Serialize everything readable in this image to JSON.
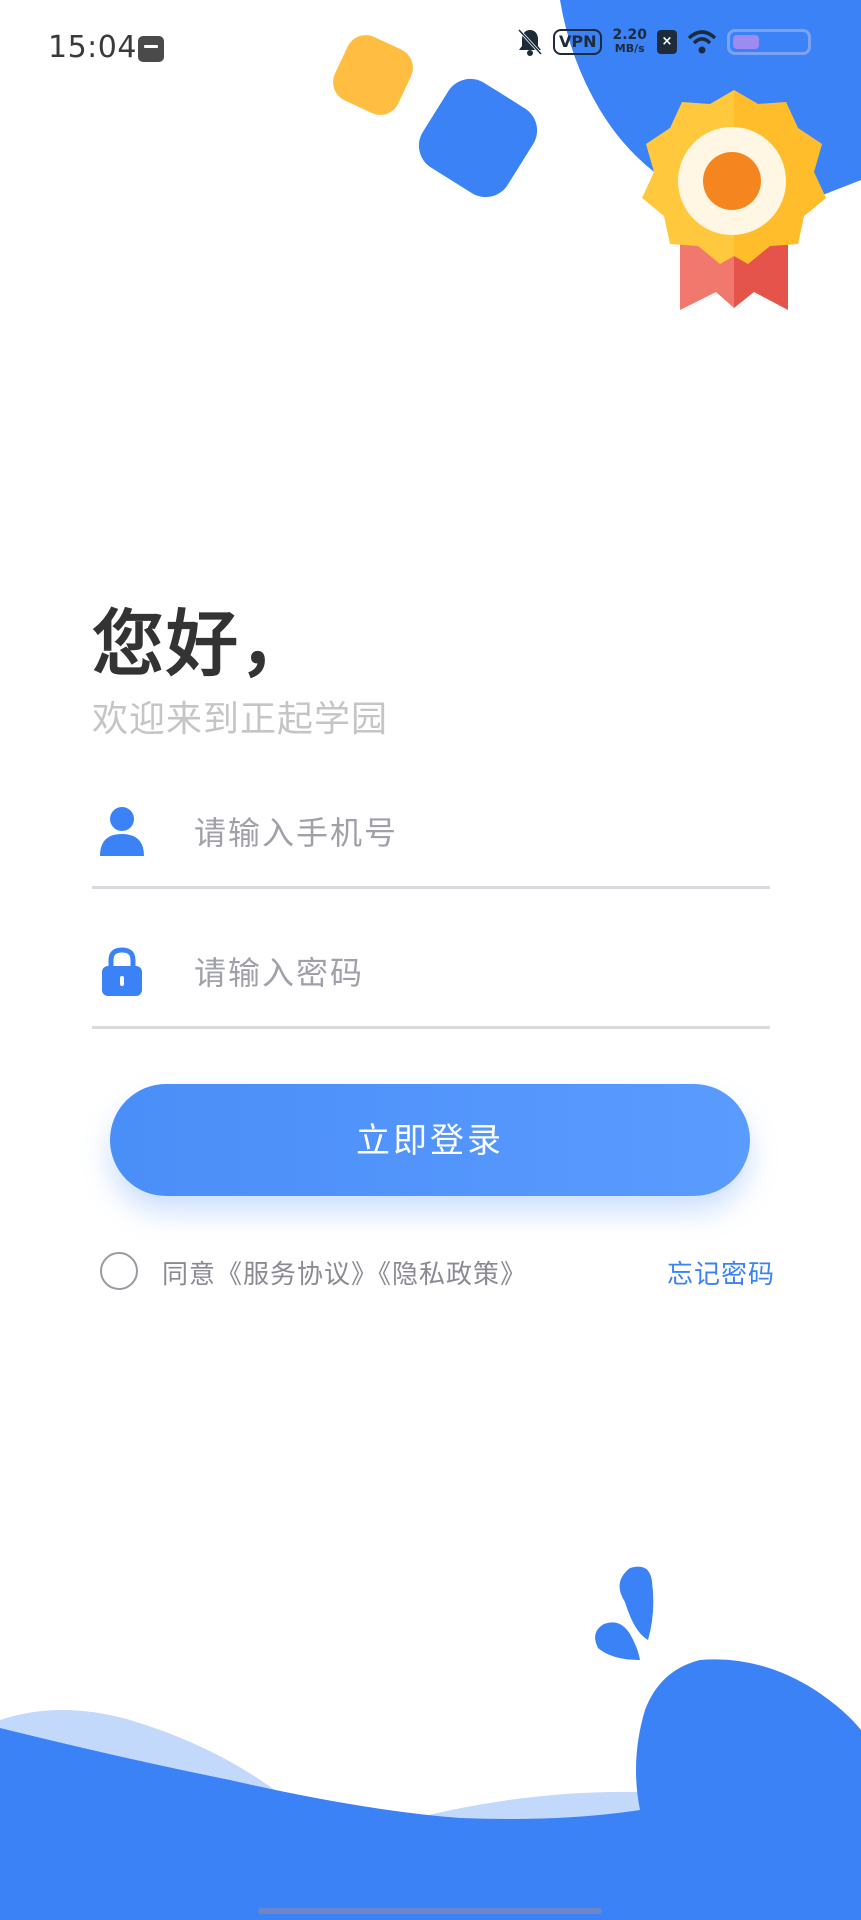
{
  "status_bar": {
    "time": "15:04",
    "vpn": "VPN",
    "net_speed_value": "2.20",
    "net_speed_unit": "MB/s",
    "icons": [
      "notification-box-icon",
      "mute-bell-icon",
      "vpn-icon",
      "x-badge-icon",
      "wifi-icon",
      "battery-icon"
    ]
  },
  "header": {
    "greeting": "您好，",
    "welcome": "欢迎来到正起学园"
  },
  "form": {
    "phone_placeholder": "请输入手机号",
    "phone_value": "",
    "password_placeholder": "请输入密码",
    "password_value": "",
    "login_label": "立即登录",
    "agree_text": "同意《服务协议》《隐私政策》",
    "agree_checked": false,
    "forgot_label": "忘记密码"
  },
  "icons": {
    "phone_field": "user-icon",
    "password_field": "lock-icon",
    "decoration": "medal-icon"
  },
  "colors": {
    "primary": "#3b82f6",
    "button": "#4a8ef7",
    "accent_yellow": "#ffbd42",
    "medal_orange": "#f5861f",
    "ribbon_red": "#e5544b",
    "light_blue_wave": "#c2d9fb",
    "title_text": "#333333",
    "subtitle_text": "#c5c5c5"
  }
}
